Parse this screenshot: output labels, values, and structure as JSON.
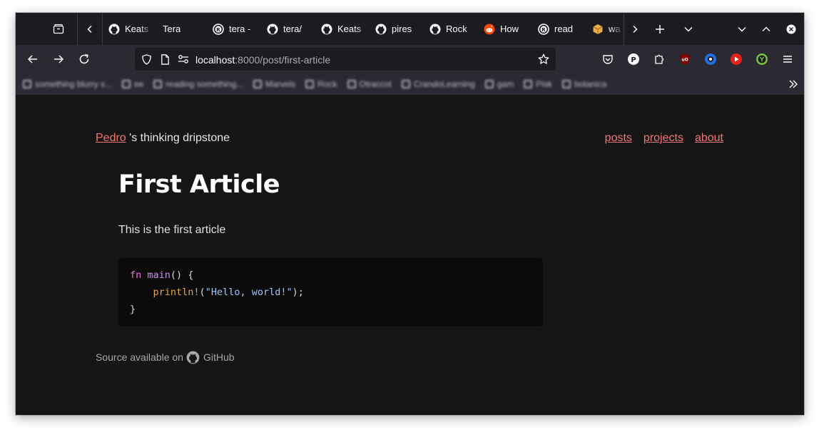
{
  "browser": {
    "tabs": [
      {
        "title": "Keats",
        "icon": "github-icon"
      },
      {
        "title": "Tera",
        "icon": "none"
      },
      {
        "title": "tera -",
        "icon": "rust-icon"
      },
      {
        "title": "tera/",
        "icon": "github-icon"
      },
      {
        "title": "Keats",
        "icon": "github-icon"
      },
      {
        "title": "pires",
        "icon": "github-icon"
      },
      {
        "title": "Rock",
        "icon": "github-icon"
      },
      {
        "title": "How",
        "icon": "reddit-icon"
      },
      {
        "title": "read",
        "icon": "rust-icon"
      },
      {
        "title": "wa",
        "icon": "package-icon"
      }
    ],
    "url_host": "localhost",
    "url_rest": ":8000/post/first-article",
    "bookmarks": [
      "something blurry s...",
      "ee",
      "reading something...",
      "Marvels",
      "Rock",
      "Otraccot",
      "CrandoLearning",
      "gam",
      "Pisk",
      "botanica"
    ]
  },
  "site": {
    "author_link": "Pedro",
    "tagline": " 's thinking dripstone",
    "nav": [
      "posts",
      "projects",
      "about"
    ]
  },
  "article": {
    "title": "First Article",
    "body": "This is the first article",
    "code": {
      "line1_kw": "fn",
      "line1_fn": "main",
      "line1_rest": "() {",
      "line2_indent": "    ",
      "line2_macro": "println!",
      "line2_open": "(",
      "line2_str": "\"Hello, world!\"",
      "line2_close": ");",
      "line3": "}"
    }
  },
  "footer": {
    "prefix": "Source available on",
    "link": "GitHub"
  },
  "colors": {
    "accent_link": "#f27474",
    "page_bg": "#151515",
    "code_bg": "#0b0b0b"
  }
}
